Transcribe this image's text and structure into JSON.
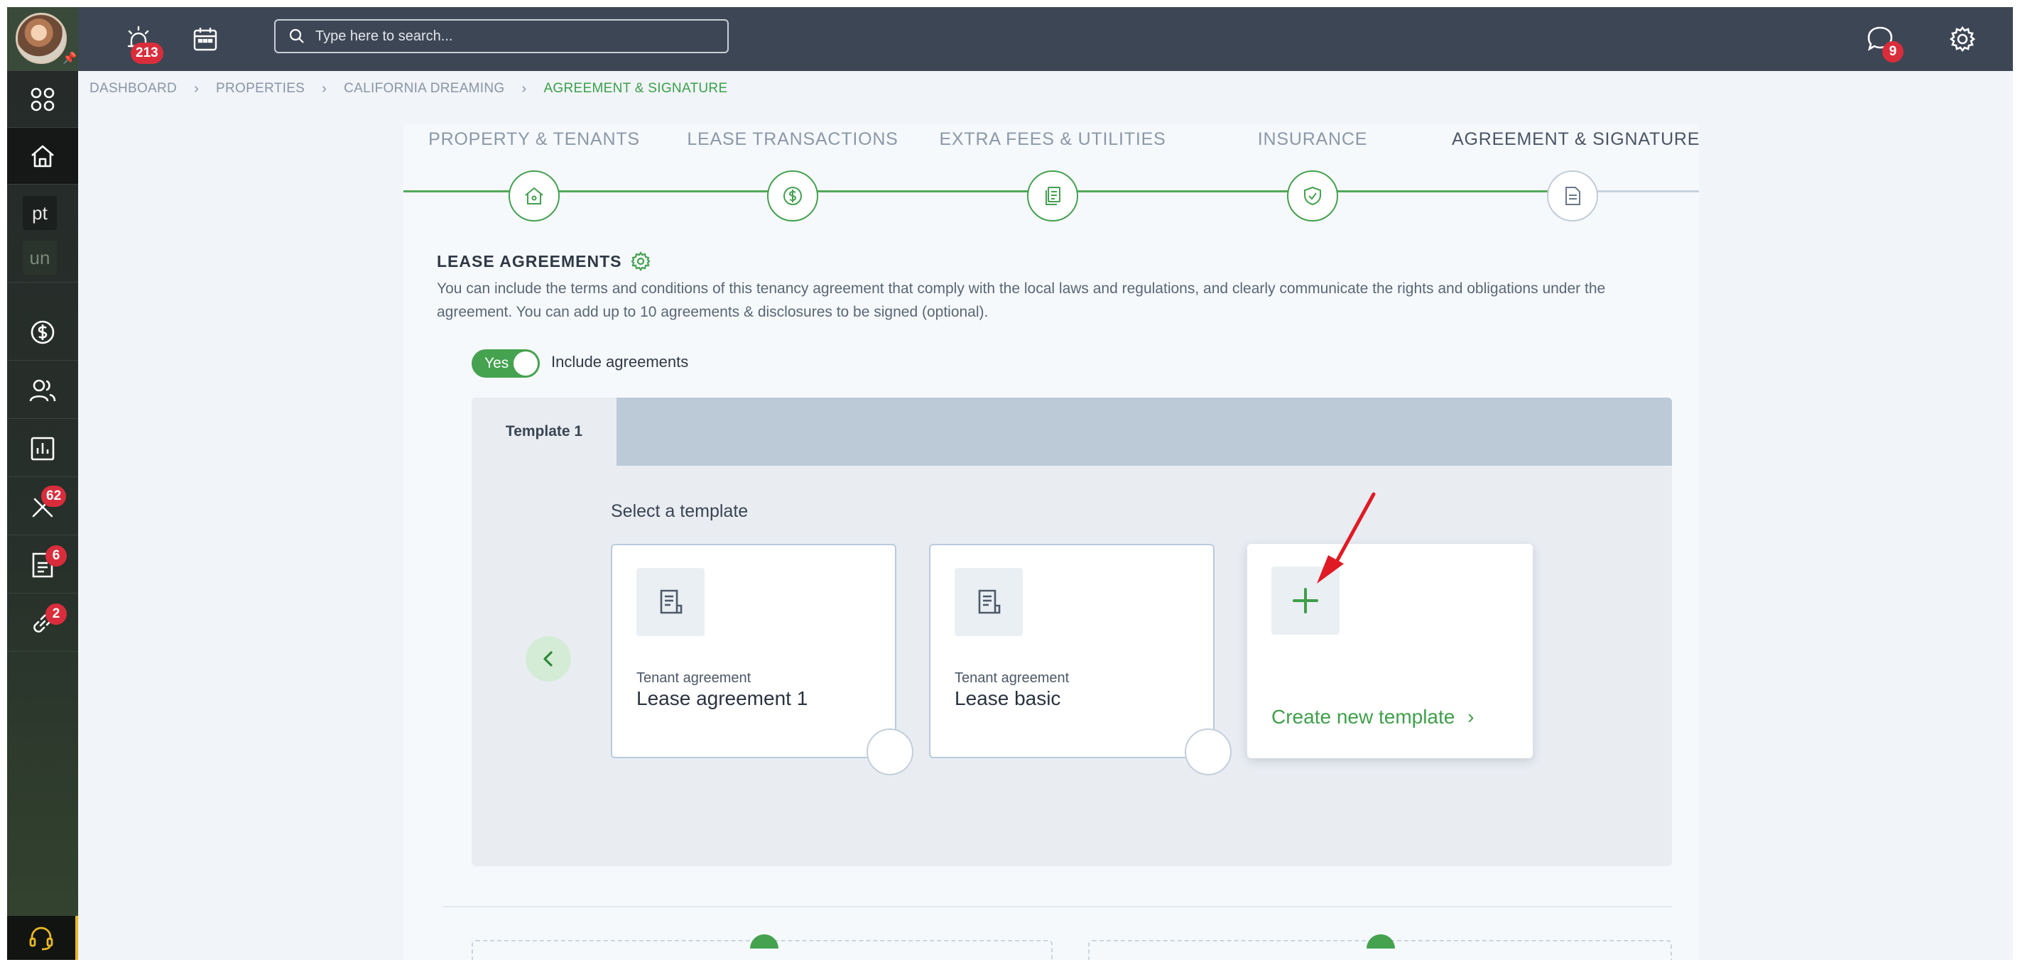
{
  "topbar": {
    "notifications_count": "213",
    "search_placeholder": "Type here to search...",
    "messages_count": "9"
  },
  "sidebar": {
    "pt_label": "pt",
    "un_label": "un",
    "tools_count": "62",
    "documents_count": "6",
    "links_count": "2"
  },
  "breadcrumb": [
    "DASHBOARD",
    "PROPERTIES",
    "CALIFORNIA DREAMING",
    "AGREEMENT & SIGNATURE"
  ],
  "steps": [
    {
      "label": "PROPERTY & TENANTS",
      "icon": "home-icon"
    },
    {
      "label": "LEASE TRANSACTIONS",
      "icon": "dollar-icon"
    },
    {
      "label": "EXTRA FEES & UTILITIES",
      "icon": "bills-icon"
    },
    {
      "label": "INSURANCE",
      "icon": "shield-icon"
    },
    {
      "label": "AGREEMENT & SIGNATURE",
      "icon": "document-icon"
    }
  ],
  "lease": {
    "title": "LEASE AGREEMENTS",
    "description": "You can include the terms and conditions of this tenancy agreement that comply with the local laws and regulations, and clearly communicate the rights and obligations under the agreement. You can add up to 10 agreements & disclosures to be signed (optional).",
    "toggle_label": "Yes",
    "toggle_text": "Include agreements"
  },
  "templates": {
    "tab_label": "Template 1",
    "select_title": "Select a template",
    "cards": [
      {
        "type": "Tenant agreement",
        "name": "Lease agreement 1"
      },
      {
        "type": "Tenant agreement",
        "name": "Lease basic"
      }
    ],
    "create_label": "Create new template",
    "create_chevron": "›"
  },
  "colors": {
    "accent_green": "#45a24f",
    "topbar": "#3d4654",
    "badge_red": "#d92d3c"
  }
}
